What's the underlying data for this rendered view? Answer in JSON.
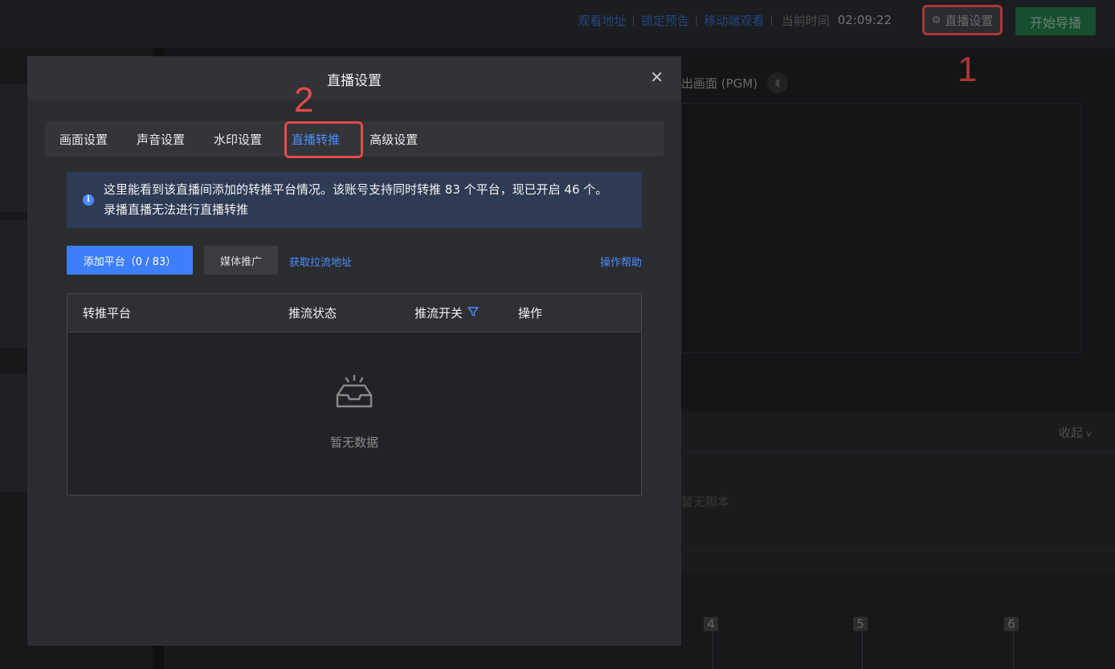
{
  "topbar": {
    "links": [
      "观看地址",
      "锁定预告",
      "移动端观看"
    ],
    "time_label": "当前时间",
    "time": "02:09:22",
    "settings_label": "直播设置",
    "start_label": "开始导播"
  },
  "annotations": {
    "step1": "1",
    "step2": "2"
  },
  "background": {
    "pgm_label": "出画面 (PGM)",
    "collapse_label": "收起",
    "no_script": "暂无脚本",
    "channels": [
      "4",
      "5",
      "6"
    ]
  },
  "modal": {
    "title": "直播设置",
    "tabs": [
      {
        "label": "画面设置",
        "active": false
      },
      {
        "label": "声音设置",
        "active": false
      },
      {
        "label": "水印设置",
        "active": false
      },
      {
        "label": "直播转推",
        "active": true
      },
      {
        "label": "高级设置",
        "active": false
      }
    ],
    "info": "这里能看到该直播间添加的转推平台情况。该账号支持同时转推 83 个平台，现已开启 46 个。录播直播无法进行直播转推",
    "buttons": {
      "add_platform": "添加平台（0 / 83）",
      "media_promo": "媒体推广",
      "get_pull_url": "获取拉流地址",
      "help": "操作帮助"
    },
    "table": {
      "columns": [
        "转推平台",
        "推流状态",
        "推流开关",
        "操作"
      ],
      "rows": [],
      "empty_text": "暂无数据"
    }
  },
  "colors": {
    "accent": "#4d8cff",
    "primary_button": "#3c7efb",
    "start_button": "#1d6a3e",
    "highlight": "#e34a4a"
  }
}
